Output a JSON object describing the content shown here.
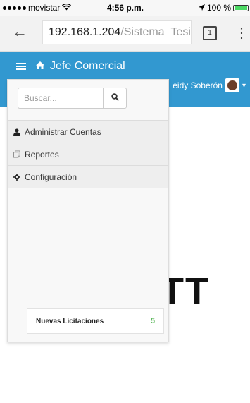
{
  "status_bar": {
    "carrier": "movistar",
    "time": "4:56 p.m.",
    "battery": "100 %",
    "battery_level": 1.0
  },
  "browser": {
    "url_host": "192.168.1.204",
    "url_path": "/Sistema_Tesis",
    "tab_count": "1",
    "back_icon": "←",
    "menu_icon": "⋮"
  },
  "navbar": {
    "brand": "Jefe Comercial",
    "user_name": "eidy Soberón"
  },
  "sidebar": {
    "search_placeholder": "Buscar...",
    "items": [
      {
        "label": "Administrar Cuentas",
        "icon": "user-icon"
      },
      {
        "label": "Reportes",
        "icon": "copy-icon"
      },
      {
        "label": "Configuración",
        "icon": "gear-icon"
      }
    ],
    "notification": {
      "label": "Nuevas Licitaciones",
      "count": "5"
    }
  },
  "main": {
    "partial_text": "TT"
  },
  "colors": {
    "navbar": "#3298d0",
    "badge": "#5cb85c"
  }
}
